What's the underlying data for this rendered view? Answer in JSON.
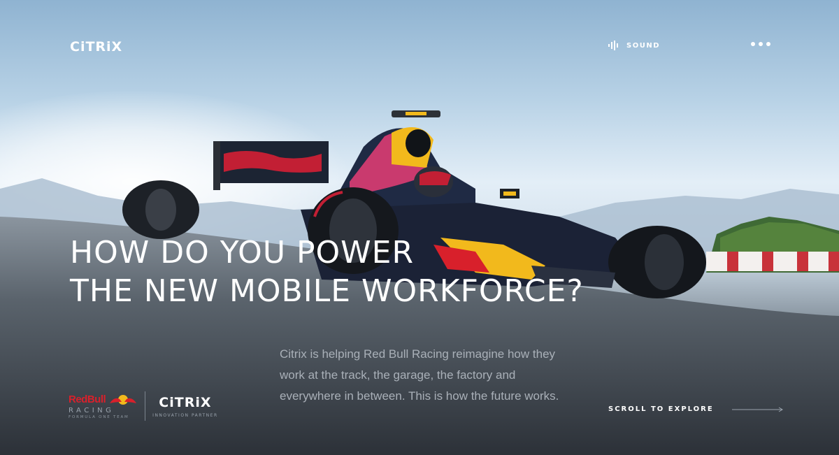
{
  "brand": {
    "logo_text": "CiTRiX"
  },
  "header": {
    "sound_label": "SOUND"
  },
  "hero": {
    "headline_line1": "HOW DO YOU POWER",
    "headline_line2": "THE NEW MOBILE WORKFORCE?",
    "body": "Citrix is helping Red Bull Racing reimagine how they work at the track, the garage, the factory and everywhere in between. This is how the future works."
  },
  "partners": {
    "redbull_word": "RedBull",
    "redbull_racing": "RACING",
    "redbull_sub": "FORMULA ONE TEAM",
    "citrix_logo": "CiTRiX",
    "citrix_sub": "INNOVATION PARTNER"
  },
  "cta": {
    "scroll_label": "SCROLL TO EXPLORE"
  },
  "colors": {
    "redbull_red": "#d8202b",
    "redbull_yellow": "#f2b91c",
    "white": "#ffffff"
  },
  "icons": [
    "sound-wave-icon",
    "more-dots-icon",
    "arrow-right-icon",
    "red-bull-emblem-icon"
  ]
}
